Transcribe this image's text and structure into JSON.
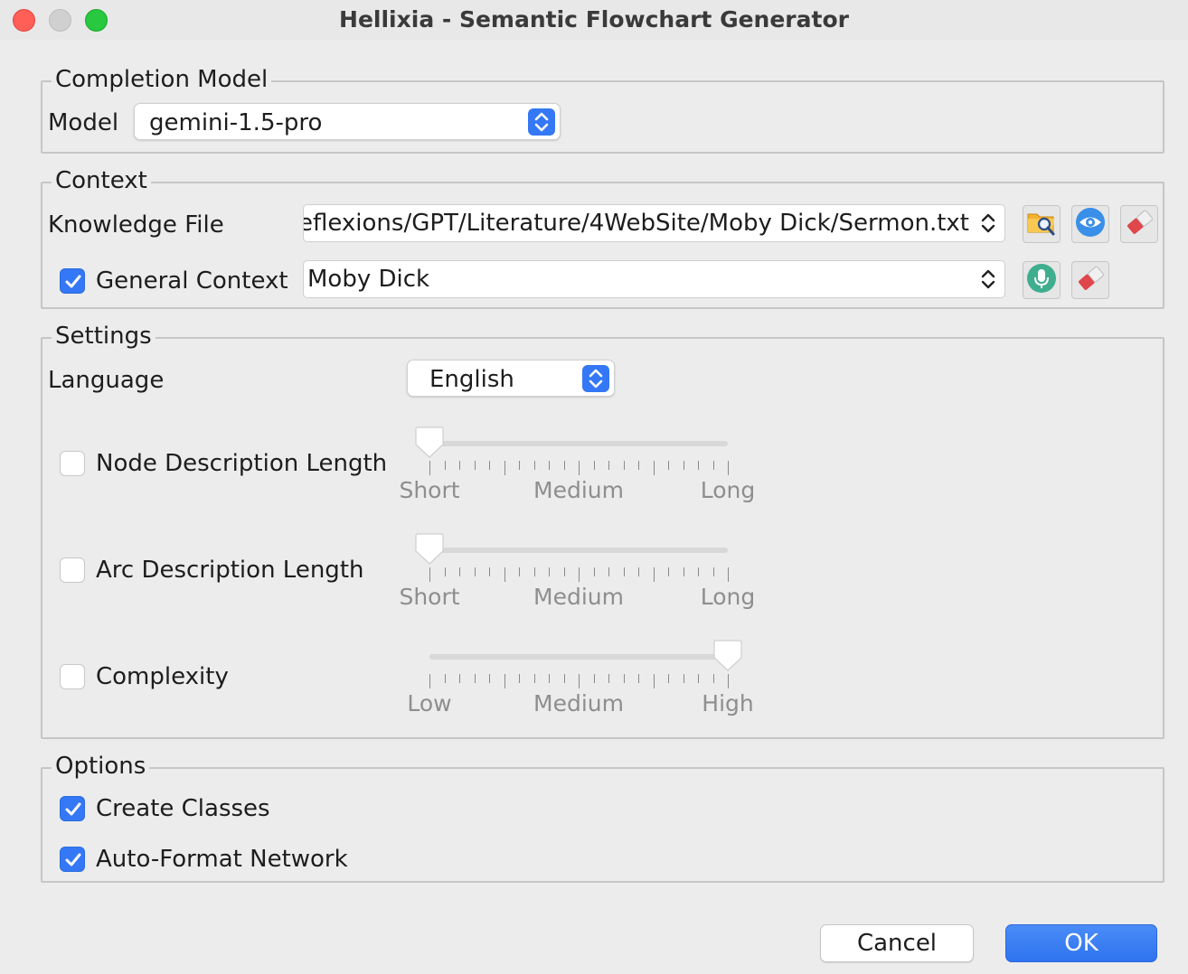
{
  "window": {
    "title": "Hellixia - Semantic Flowchart Generator",
    "controls": [
      "close",
      "minimize",
      "zoom"
    ]
  },
  "completion_model": {
    "legend": "Completion Model",
    "model_label": "Model",
    "model_value": "gemini-1.5-pro"
  },
  "context": {
    "legend": "Context",
    "knowledge_file_label": "Knowledge File",
    "knowledge_file_value": "eflexions/GPT/Literature/4WebSite/Moby Dick/Sermon.txt",
    "knowledge_file_buttons": [
      "browse-folder-icon",
      "eye-icon",
      "eraser-icon"
    ],
    "general_context_label": "General Context",
    "general_context_checked": true,
    "general_context_value": "Moby Dick",
    "general_context_buttons": [
      "microphone-icon",
      "eraser-icon"
    ]
  },
  "settings": {
    "legend": "Settings",
    "language_label": "Language",
    "language_value": "English",
    "node_description": {
      "label": "Node Description Length",
      "checked": false,
      "level": 0.0,
      "labels": [
        "Short",
        "Medium",
        "Long"
      ]
    },
    "arc_description": {
      "label": "Arc Description Length",
      "checked": false,
      "level": 0.0,
      "labels": [
        "Short",
        "Medium",
        "Long"
      ]
    },
    "complexity": {
      "label": "Complexity",
      "checked": false,
      "level": 1.0,
      "labels": [
        "Low",
        "Medium",
        "High"
      ]
    }
  },
  "options": {
    "legend": "Options",
    "create_classes_label": "Create Classes",
    "create_classes_checked": true,
    "auto_format_label": "Auto-Format Network",
    "auto_format_checked": true
  },
  "buttons": {
    "cancel": "Cancel",
    "ok": "OK"
  },
  "colors": {
    "accent": "#3478f6",
    "close": "#ff5f57",
    "zoom": "#28c840",
    "eraser_red": "#e0464a",
    "mic_green": "#3fae8f"
  }
}
